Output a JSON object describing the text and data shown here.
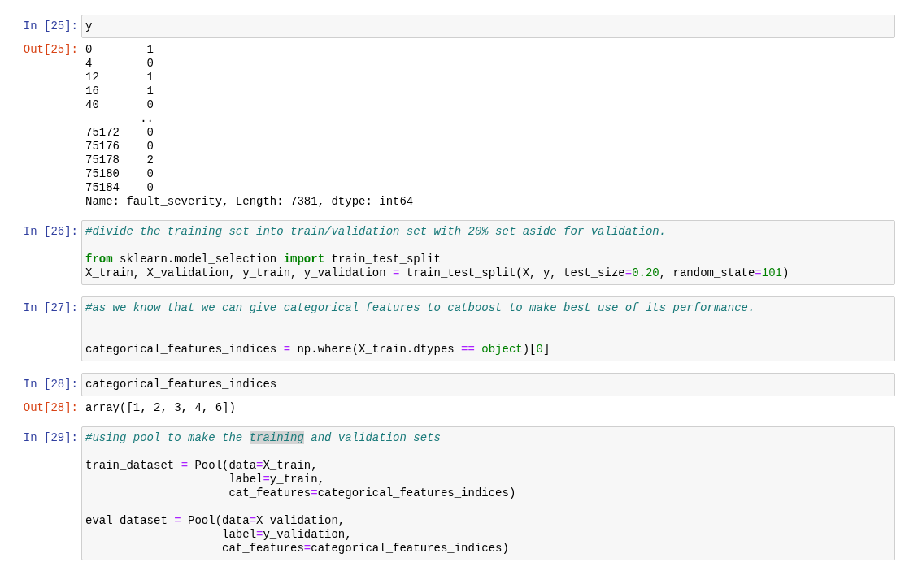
{
  "cells": [
    {
      "prompt": "In [25]:",
      "lines": [
        {
          "kind": "code",
          "tokens": [
            {
              "text": "y",
              "kind": "plain"
            }
          ]
        }
      ],
      "output": {
        "prompt": "Out[25]:",
        "lines": [
          "0        1",
          "4        0",
          "12       1",
          "16       1",
          "40       0",
          "        ..",
          "75172    0",
          "75176    0",
          "75178    2",
          "75180    0",
          "75184    0",
          "Name: fault_severity, Length: 7381, dtype: int64"
        ]
      }
    },
    {
      "prompt": "In [26]:",
      "lines": [
        {
          "kind": "code",
          "tokens": [
            {
              "text": "#divide the training set into train/validation set with 20% set aside for validation.",
              "kind": "comment"
            }
          ]
        },
        {
          "kind": "blank"
        },
        {
          "kind": "code",
          "tokens": [
            {
              "text": "from",
              "kind": "keyword"
            },
            {
              "text": " sklearn.model_selection ",
              "kind": "plain"
            },
            {
              "text": "import",
              "kind": "keyword"
            },
            {
              "text": " train_test_split",
              "kind": "plain"
            }
          ]
        },
        {
          "kind": "code",
          "tokens": [
            {
              "text": "X_train, X_validation, y_train, y_validation ",
              "kind": "plain"
            },
            {
              "text": "=",
              "kind": "op"
            },
            {
              "text": " train_test_split(X, y, test_size",
              "kind": "plain"
            },
            {
              "text": "=",
              "kind": "op"
            },
            {
              "text": "0.20",
              "kind": "number"
            },
            {
              "text": ", random_state",
              "kind": "plain"
            },
            {
              "text": "=",
              "kind": "op"
            },
            {
              "text": "101",
              "kind": "number"
            },
            {
              "text": ")",
              "kind": "plain"
            }
          ]
        }
      ]
    },
    {
      "prompt": "In [27]:",
      "lines": [
        {
          "kind": "code",
          "tokens": [
            {
              "text": "#as we know that we can give categorical features to catboost to make best use of its performance.",
              "kind": "comment"
            }
          ]
        },
        {
          "kind": "blank"
        },
        {
          "kind": "blank"
        },
        {
          "kind": "code",
          "tokens": [
            {
              "text": "categorical_features_indices ",
              "kind": "plain"
            },
            {
              "text": "=",
              "kind": "op"
            },
            {
              "text": " np.where(X_train.dtypes ",
              "kind": "plain"
            },
            {
              "text": "==",
              "kind": "op"
            },
            {
              "text": " object",
              "kind": "builtin"
            },
            {
              "text": ")[",
              "kind": "plain"
            },
            {
              "text": "0",
              "kind": "number"
            },
            {
              "text": "]",
              "kind": "plain"
            }
          ]
        }
      ]
    },
    {
      "prompt": "In [28]:",
      "lines": [
        {
          "kind": "code",
          "tokens": [
            {
              "text": "categorical_features_indices",
              "kind": "plain"
            }
          ]
        }
      ],
      "output": {
        "prompt": "Out[28]:",
        "lines": [
          "array([1, 2, 3, 4, 6])"
        ]
      }
    },
    {
      "prompt": "In [29]:",
      "lines": [
        {
          "kind": "code",
          "tokens": [
            {
              "text": "#using pool to make the ",
              "kind": "comment"
            },
            {
              "text": "training",
              "kind": "comment",
              "highlighted": true
            },
            {
              "text": " and validation sets",
              "kind": "comment"
            }
          ]
        },
        {
          "kind": "blank"
        },
        {
          "kind": "code",
          "tokens": [
            {
              "text": "train_dataset ",
              "kind": "plain"
            },
            {
              "text": "=",
              "kind": "op"
            },
            {
              "text": " Pool(data",
              "kind": "plain"
            },
            {
              "text": "=",
              "kind": "op"
            },
            {
              "text": "X_train,",
              "kind": "plain"
            }
          ]
        },
        {
          "kind": "code",
          "tokens": [
            {
              "text": "                     label",
              "kind": "plain"
            },
            {
              "text": "=",
              "kind": "op"
            },
            {
              "text": "y_train,",
              "kind": "plain"
            }
          ]
        },
        {
          "kind": "code",
          "tokens": [
            {
              "text": "                     cat_features",
              "kind": "plain"
            },
            {
              "text": "=",
              "kind": "op"
            },
            {
              "text": "categorical_features_indices)",
              "kind": "plain"
            }
          ]
        },
        {
          "kind": "blank"
        },
        {
          "kind": "code",
          "tokens": [
            {
              "text": "eval_dataset ",
              "kind": "plain"
            },
            {
              "text": "=",
              "kind": "op"
            },
            {
              "text": " Pool(data",
              "kind": "plain"
            },
            {
              "text": "=",
              "kind": "op"
            },
            {
              "text": "X_validation,",
              "kind": "plain"
            }
          ]
        },
        {
          "kind": "code",
          "tokens": [
            {
              "text": "                    label",
              "kind": "plain"
            },
            {
              "text": "=",
              "kind": "op"
            },
            {
              "text": "y_validation,",
              "kind": "plain"
            }
          ]
        },
        {
          "kind": "code",
          "tokens": [
            {
              "text": "                    cat_features",
              "kind": "plain"
            },
            {
              "text": "=",
              "kind": "op"
            },
            {
              "text": "categorical_features_indices)",
              "kind": "plain"
            }
          ]
        }
      ]
    }
  ]
}
